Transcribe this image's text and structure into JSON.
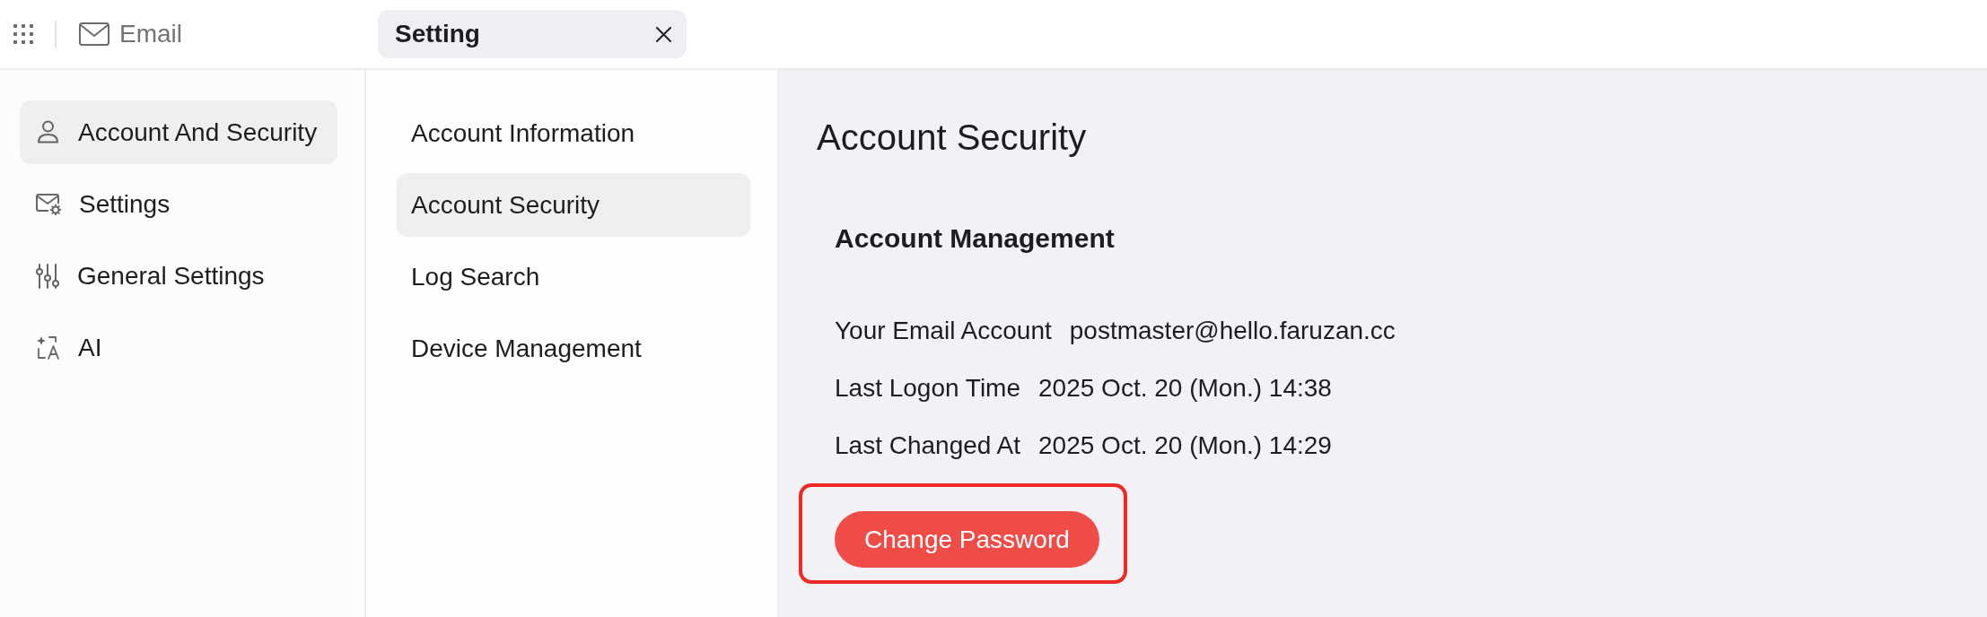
{
  "top_bar": {
    "app_label": "Email",
    "tab": {
      "label": "Setting",
      "selected": true
    }
  },
  "sidebar": {
    "items": [
      {
        "label": "Account And Security",
        "selected": true
      },
      {
        "label": "Settings",
        "selected": false
      },
      {
        "label": "General Settings",
        "selected": false
      },
      {
        "label": "AI",
        "selected": false
      }
    ]
  },
  "submenu": {
    "items": [
      {
        "label": "Account Information",
        "selected": false
      },
      {
        "label": "Account Security",
        "selected": true
      },
      {
        "label": "Log Search",
        "selected": false
      },
      {
        "label": "Device Management",
        "selected": false
      }
    ]
  },
  "content": {
    "title": "Account Security",
    "section": {
      "title": "Account Management",
      "fields": [
        {
          "label": "Your Email Account",
          "value": "postmaster@hello.faruzan.cc"
        },
        {
          "label": "Last Logon Time",
          "value": "2025 Oct. 20 (Mon.) 14:38"
        },
        {
          "label": "Last Changed At",
          "value": "2025 Oct. 20 (Mon.) 14:29"
        }
      ]
    },
    "button": {
      "label": "Change Password",
      "highlighted": true
    }
  }
}
